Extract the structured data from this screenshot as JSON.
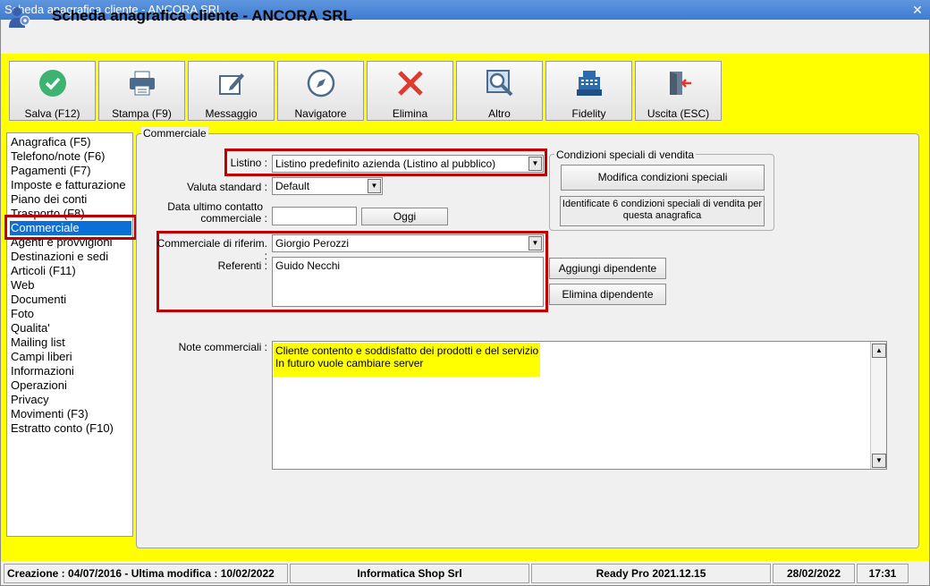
{
  "window": {
    "title": "Scheda anagrafica cliente - ANCORA SRL",
    "close_glyph": "✕"
  },
  "header": {
    "title": "Scheda anagrafica cliente - ANCORA SRL"
  },
  "toolbar": [
    {
      "label": "Salva (F12)",
      "icon": "check-icon"
    },
    {
      "label": "Stampa (F9)",
      "icon": "printer-icon"
    },
    {
      "label": "Messaggio",
      "icon": "message-icon"
    },
    {
      "label": "Navigatore",
      "icon": "compass-icon"
    },
    {
      "label": "Elimina",
      "icon": "delete-icon"
    },
    {
      "label": "Altro",
      "icon": "search-icon"
    },
    {
      "label": "Fidelity",
      "icon": "cash-register-icon"
    },
    {
      "label": "Uscita (ESC)",
      "icon": "exit-icon"
    }
  ],
  "nav": [
    "Anagrafica (F5)",
    "Telefono/note (F6)",
    "Pagamenti (F7)",
    "Imposte e fatturazione",
    "Piano dei conti",
    "Trasporto (F8)",
    "Commerciale",
    "Agenti e provvigioni",
    "Destinazioni e sedi",
    "Articoli (F11)",
    "Web",
    "Documenti",
    "Foto",
    "Qualita'",
    "Mailing list",
    "Campi liberi",
    "Informazioni",
    "Operazioni",
    "Privacy",
    "Movimenti (F3)",
    "Estratto conto (F10)"
  ],
  "nav_selected": "Commerciale",
  "panel": {
    "legend": "Commerciale",
    "listino_label": "Listino :",
    "listino_value": "Listino predefinito azienda (Listino al pubblico)",
    "valuta_label": "Valuta standard :",
    "valuta_value": "Default",
    "data_label_1": "Data ultimo contatto",
    "data_label_2": "commerciale :",
    "data_value": "",
    "oggi_button": "Oggi",
    "commerciale_label": "Commerciale di riferim. :",
    "commerciale_value": "Giorgio Perozzi",
    "referenti_label": "Referenti :",
    "referenti_value": "Guido Necchi",
    "add_dip_button": "Aggiungi dipendente",
    "del_dip_button": "Elimina dipendente",
    "cond_legend": "Condizioni speciali di vendita",
    "cond_button": "Modifica condizioni speciali",
    "cond_info": "Identificate 6 condizioni speciali di vendita per questa anagrafica",
    "note_label": "Note commerciali :",
    "note_line_1": "Cliente contento e soddisfatto dei prodotti e del servizio",
    "note_line_2": "In futuro vuole cambiare server"
  },
  "status": {
    "dates": "Creazione : 04/07/2016 - Ultima modifica : 10/02/2022",
    "company": "Informatica Shop Srl",
    "version": "Ready Pro 2021.12.15",
    "date": "28/02/2022",
    "time": "17:31"
  },
  "colors": {
    "work_area": "#ffff00",
    "selection": "#0a6fd6",
    "highlight_box": "#c00000",
    "note_highlight": "#ffff00"
  }
}
